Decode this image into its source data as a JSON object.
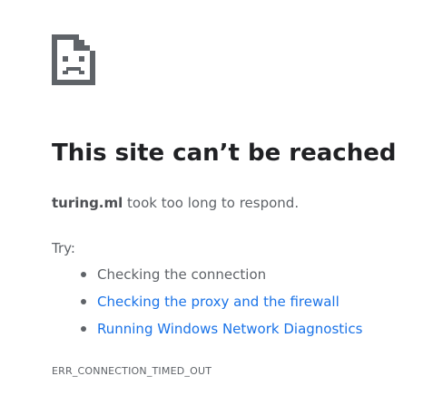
{
  "icon": "sad-page-icon",
  "title": "This site can’t be reached",
  "summary": {
    "host": "turing.ml",
    "message": " took too long to respond."
  },
  "try_label": "Try:",
  "suggestions": [
    {
      "label": "Checking the connection",
      "is_link": false
    },
    {
      "label": "Checking the proxy and the firewall",
      "is_link": true
    },
    {
      "label": "Running Windows Network Diagnostics",
      "is_link": true
    }
  ],
  "error_code": "ERR_CONNECTION_TIMED_OUT",
  "colors": {
    "text": "#202124",
    "secondary_text": "#5f6368",
    "link": "#1a73e8",
    "icon": "#5f6368",
    "background": "#ffffff"
  }
}
